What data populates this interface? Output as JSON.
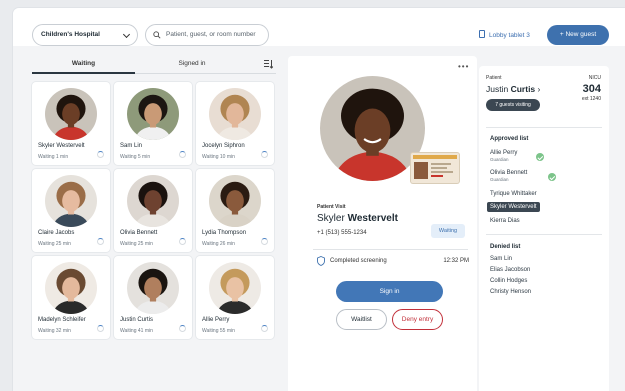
{
  "topbar": {
    "location": "Children's Hospital",
    "search_placeholder": "Patient, guest, or room number",
    "tablet_label": "Lobby tablet 3",
    "new_guest_label": "New guest"
  },
  "tabs": {
    "waiting": "Waiting",
    "signed_in": "Signed in"
  },
  "guests": [
    {
      "name": "Skyler Westervelt",
      "wait": "Waiting 1 min",
      "skin": "#6b3e26",
      "hair": "#1f140d",
      "shirt": "#c8352c",
      "bg": "#c9c3ba"
    },
    {
      "name": "Sam Lin",
      "wait": "Waiting 5 min",
      "skin": "#c99a76",
      "hair": "#1c1612",
      "shirt": "#f0f0f0",
      "bg": "#8e9a7a"
    },
    {
      "name": "Jocelyn Siphron",
      "wait": "Waiting 10 min",
      "skin": "#e2b79a",
      "hair": "#b08552",
      "shirt": "#efe9e2",
      "bg": "#e8ddd3"
    },
    {
      "name": "Claire Jacobs",
      "wait": "Waiting 25 min",
      "skin": "#e6bba0",
      "hair": "#9a6d48",
      "shirt": "#3a4a5a",
      "bg": "#e6e2dc"
    },
    {
      "name": "Olivia Bennett",
      "wait": "Waiting 25 min",
      "skin": "#6e4230",
      "hair": "#1a120e",
      "shirt": "#e8e4df",
      "bg": "#ddd7d1"
    },
    {
      "name": "Lydia Thompson",
      "wait": "Waiting 26 min",
      "skin": "#8a5a3c",
      "hair": "#2a1b12",
      "shirt": "#d9d2c6",
      "bg": "#dcd6cb"
    },
    {
      "name": "Madelyn Schleifer",
      "wait": "Waiting 32 min",
      "skin": "#e4b99c",
      "hair": "#6a4a32",
      "shirt": "#2a2a2a",
      "bg": "#efeae4"
    },
    {
      "name": "Justin Curtis",
      "wait": "Waiting 41 min",
      "skin": "#b07f5e",
      "hair": "#1a1410",
      "shirt": "#ececec",
      "bg": "#e4e1dd"
    },
    {
      "name": "Allie Perry",
      "wait": "Waiting 55 min",
      "skin": "#e9c2a4",
      "hair": "#c49a5c",
      "shirt": "#2b2b2b",
      "bg": "#eeeae5"
    }
  ],
  "visit": {
    "label": "Patient Visit",
    "first_name": "Skyler",
    "last_name": "Westervelt",
    "phone": "+1 (513) 555-1234",
    "status": "Waiting",
    "screening_text": "Completed screening",
    "screening_time": "12:32 PM",
    "sign_in_label": "Sign in",
    "waitlist_label": "Waitlist",
    "deny_label": "Deny entry",
    "more": "•••"
  },
  "patient": {
    "label": "Patient",
    "first_name": "Justin",
    "last_name": "Curtis",
    "chevron": "›",
    "unit": "NICU",
    "room": "304",
    "ext": "ext 1240",
    "guests_visiting": "7 guests visiting"
  },
  "approved": {
    "title": "Approved list",
    "items": [
      {
        "name": "Allie Perry",
        "sub": "Guardian"
      },
      {
        "name": "Olivia Bennett",
        "sub": "Guardian"
      },
      {
        "name": "Tyrique Whittaker",
        "sub": ""
      },
      {
        "name": "Skyler Westervelt",
        "sub": ""
      },
      {
        "name": "Kierra Dias",
        "sub": ""
      }
    ]
  },
  "denied": {
    "title": "Denied list",
    "items": [
      "Sam Lin",
      "Elias Jacobson",
      "Collin Hodges",
      "Christy Henson"
    ]
  },
  "colors": {
    "primary": "#3e71ae",
    "deny": "#c2303a",
    "dark_pill": "#3b4752",
    "check": "#7cc48a"
  }
}
